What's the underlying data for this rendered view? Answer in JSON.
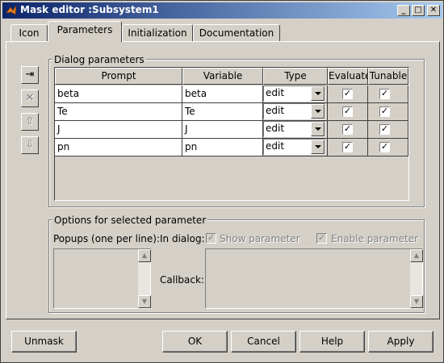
{
  "window": {
    "title": "Mask editor :Subsystem1"
  },
  "tabs": [
    "Icon",
    "Parameters",
    "Initialization",
    "Documentation"
  ],
  "active_tab": "Parameters",
  "dialog_parameters": {
    "title": "Dialog parameters",
    "columns": [
      "Prompt",
      "Variable",
      "Type",
      "Evaluate",
      "Tunable"
    ],
    "rows": [
      {
        "prompt": "beta",
        "variable": "beta",
        "type": "edit",
        "evaluate": true,
        "tunable": true
      },
      {
        "prompt": "Te",
        "variable": "Te",
        "type": "edit",
        "evaluate": true,
        "tunable": true
      },
      {
        "prompt": "J",
        "variable": "J",
        "type": "edit",
        "evaluate": true,
        "tunable": true
      },
      {
        "prompt": "pn",
        "variable": "pn",
        "type": "edit",
        "evaluate": true,
        "tunable": true
      }
    ]
  },
  "options": {
    "title": "Options for selected parameter",
    "popups_label": "Popups (one per line):",
    "in_dialog_label": "In dialog:",
    "show_parameter": {
      "label": "Show parameter",
      "checked": true
    },
    "enable_parameter": {
      "label": "Enable parameter",
      "checked": true
    },
    "callback_label": "Callback:"
  },
  "buttons": {
    "unmask": "Unmask",
    "ok": "OK",
    "cancel": "Cancel",
    "help": "Help",
    "apply": "Apply"
  },
  "glyphs": {
    "check": "✓",
    "minimize": "_",
    "maximize": "□",
    "close": "✕",
    "add": "⇥",
    "delete": "✕",
    "move_up": "⇧",
    "move_down": "⇩",
    "scroll_up": "▲",
    "scroll_down": "▼"
  }
}
